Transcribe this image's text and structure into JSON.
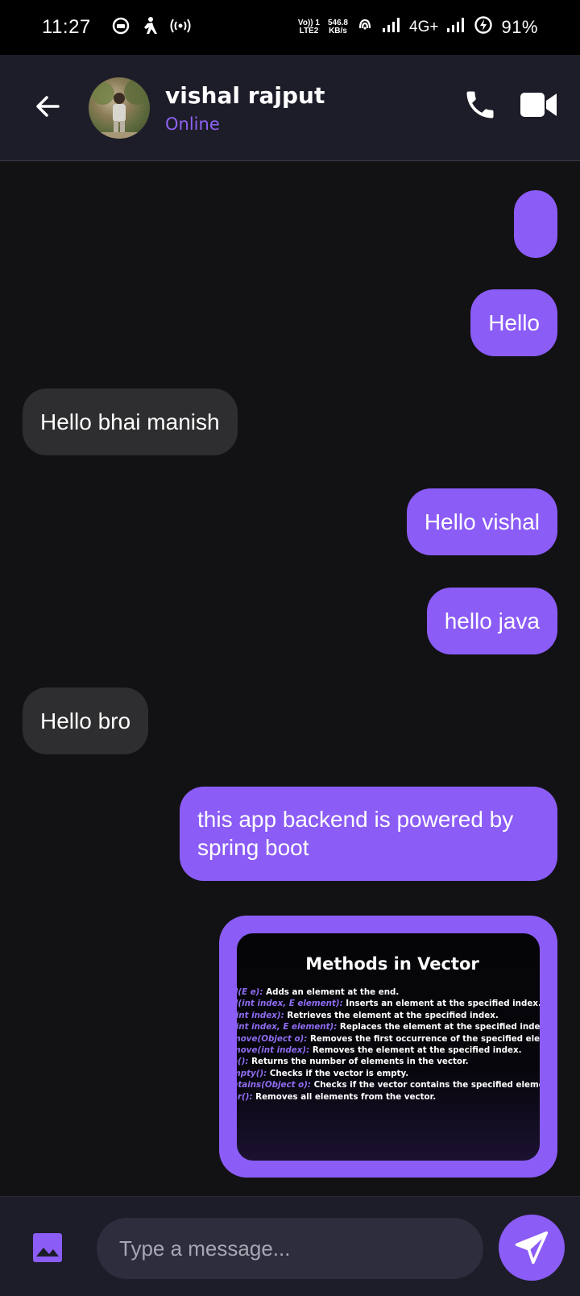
{
  "status_bar": {
    "time": "11:27",
    "volte": "Vo)) 1",
    "lte": "LTE2",
    "speed_value": "546.8",
    "speed_unit": "KB/s",
    "network": "4G+",
    "battery": "91%"
  },
  "header": {
    "contact_name": "vishal rajput",
    "contact_status": "Online"
  },
  "messages": [
    {
      "type": "sent",
      "text": ""
    },
    {
      "type": "sent",
      "text": "Hello"
    },
    {
      "type": "received",
      "text": "Hello bhai manish"
    },
    {
      "type": "sent",
      "text": "Hello vishal"
    },
    {
      "type": "sent",
      "text": "hello java"
    },
    {
      "type": "received",
      "text": "Hello bro"
    },
    {
      "type": "sent",
      "text": "this app backend is powered by spring boot"
    }
  ],
  "image_message": {
    "title": "Methods in Vector",
    "lines": [
      {
        "method": "d(E e):",
        "desc": " Adds an element at the end."
      },
      {
        "method": "d(int index, E element):",
        "desc": " Inserts an element at the specified index."
      },
      {
        "method": "(int index):",
        "desc": " Retrieves the element at the specified index."
      },
      {
        "method": "(int index, E element):",
        "desc": " Replaces the element at the specified index."
      },
      {
        "method": "move(Object o):",
        "desc": " Removes the first occurrence of the specified element."
      },
      {
        "method": "move(int index):",
        "desc": " Removes the element at the specified index."
      },
      {
        "method": "e():",
        "desc": " Returns the number of elements in the vector."
      },
      {
        "method": "mpty():",
        "desc": " Checks if the vector is empty."
      },
      {
        "method": "ntains(Object o):",
        "desc": " Checks if the vector contains the specified element."
      },
      {
        "method": "ar():",
        "desc": " Removes all elements from the vector."
      }
    ]
  },
  "composer": {
    "placeholder": "Type a message..."
  },
  "colors": {
    "accent": "#8b5cf6",
    "received_bubble": "#2e2e30",
    "header_bg": "#1d1d29",
    "chat_bg": "#121214"
  }
}
